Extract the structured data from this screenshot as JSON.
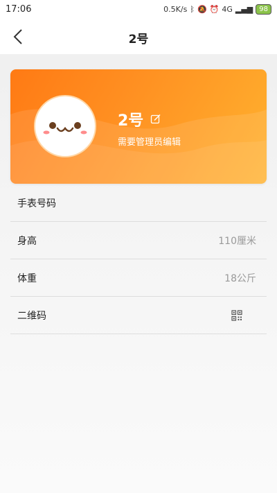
{
  "status_bar": {
    "time": "17:06",
    "network_speed": "0.5K/s",
    "network_type": "4G",
    "battery": "98"
  },
  "nav": {
    "title": "2号"
  },
  "profile": {
    "name": "2号",
    "subtitle": "需要管理员编辑",
    "accent_color": "#ff8a1f"
  },
  "info": {
    "watch_number": {
      "label": "手表号码",
      "value": ""
    },
    "height": {
      "label": "身高",
      "value": "110厘米"
    },
    "weight": {
      "label": "体重",
      "value": "18公斤"
    },
    "qr_code": {
      "label": "二维码",
      "icon": "qr-code-icon"
    }
  }
}
